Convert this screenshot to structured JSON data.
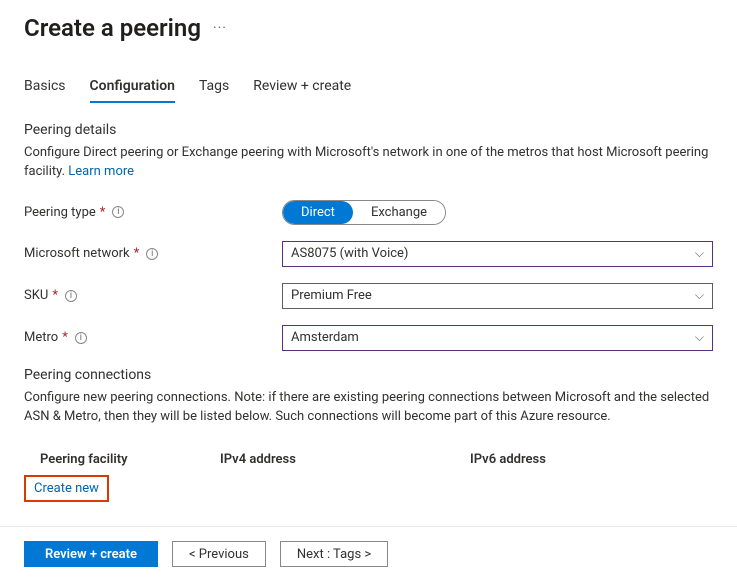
{
  "header": {
    "title": "Create a peering"
  },
  "tabs": [
    {
      "label": "Basics"
    },
    {
      "label": "Configuration"
    },
    {
      "label": "Tags"
    },
    {
      "label": "Review + create"
    }
  ],
  "activeTabIndex": 1,
  "peeringDetails": {
    "title": "Peering details",
    "description": "Configure Direct peering or Exchange peering with Microsoft's network in one of the metros that host Microsoft peering facility. ",
    "learnMore": "Learn more"
  },
  "fields": {
    "peeringType": {
      "label": "Peering type",
      "options": [
        "Direct",
        "Exchange"
      ],
      "selected": "Direct"
    },
    "microsoftNetwork": {
      "label": "Microsoft network",
      "value": "AS8075 (with Voice)"
    },
    "sku": {
      "label": "SKU",
      "value": "Premium Free"
    },
    "metro": {
      "label": "Metro",
      "value": "Amsterdam"
    }
  },
  "peeringConnections": {
    "title": "Peering connections",
    "description": "Configure new peering connections. Note: if there are existing peering connections between Microsoft and the selected ASN & Metro, then they will be listed below. Such connections will become part of this Azure resource.",
    "columns": {
      "facility": "Peering facility",
      "ipv4": "IPv4 address",
      "ipv6": "IPv6 address"
    },
    "createNew": "Create new"
  },
  "footer": {
    "reviewCreate": "Review + create",
    "previous": "< Previous",
    "next": "Next : Tags >"
  }
}
